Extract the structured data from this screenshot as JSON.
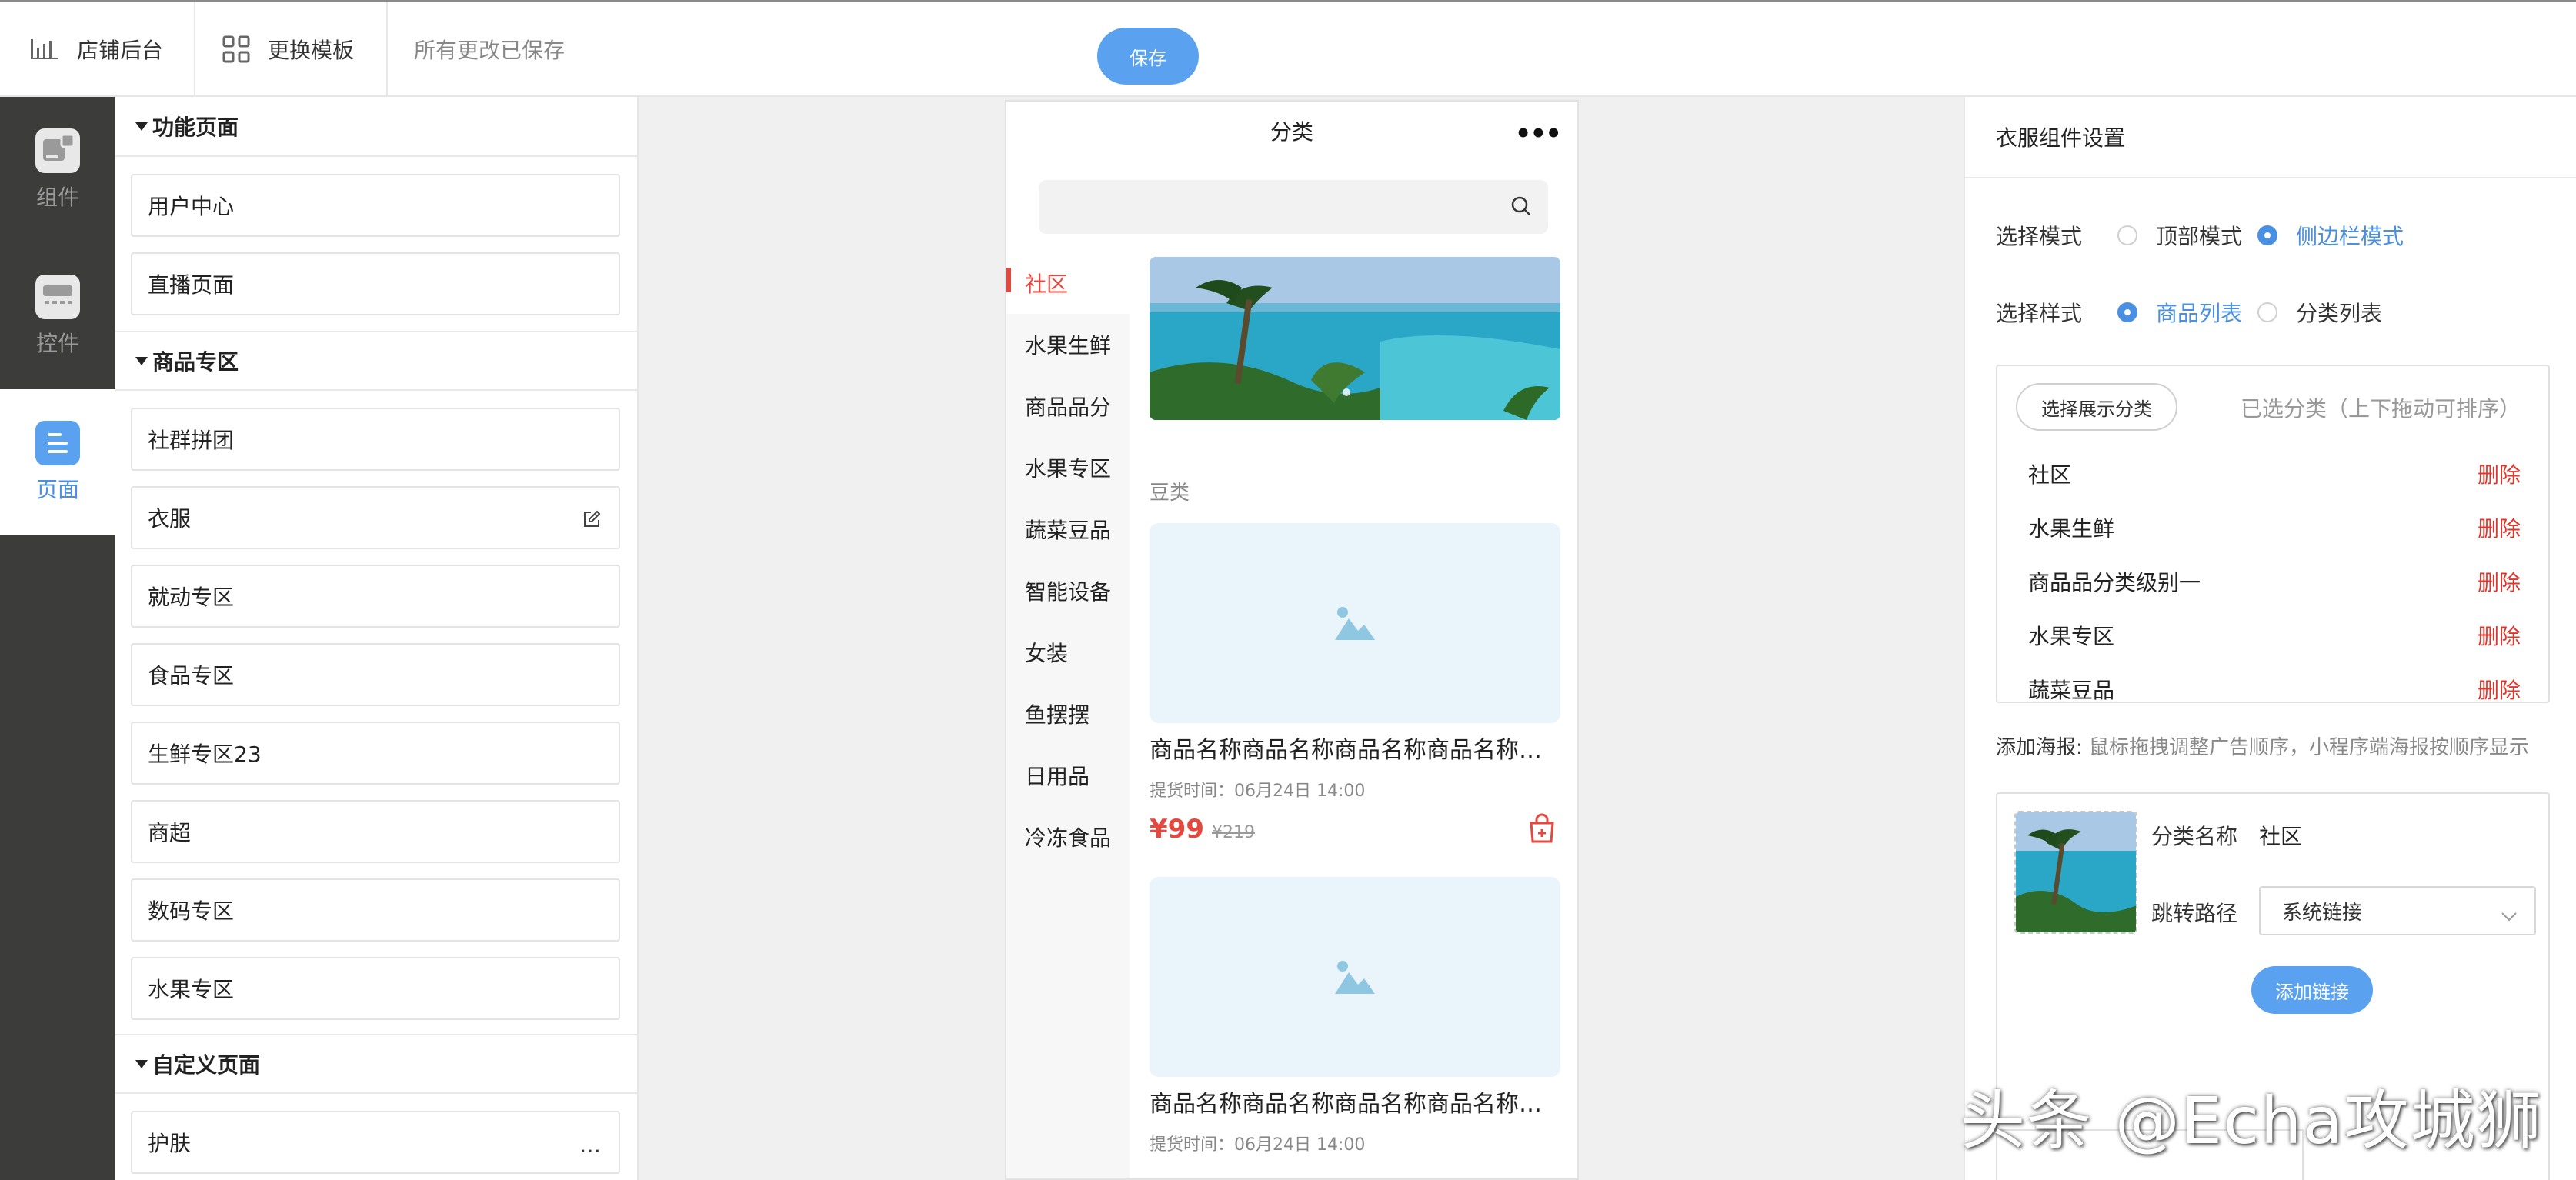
{
  "topbar": {
    "shop_admin": "店铺后台",
    "change_template": "更换模板",
    "saved_status": "所有更改已保存",
    "save_label": "保存"
  },
  "rail": {
    "items": [
      {
        "label": "组件",
        "icon": "component-icon"
      },
      {
        "label": "控件",
        "icon": "control-icon"
      },
      {
        "label": "页面",
        "icon": "page-icon",
        "active": true
      }
    ]
  },
  "left_panel": {
    "sections": [
      {
        "title": "功能页面",
        "items": [
          "用户中心",
          "直播页面"
        ]
      },
      {
        "title": "商品专区",
        "items": [
          "社群拼团",
          "衣服",
          "就动专区",
          "食品专区",
          "生鲜专区23",
          "商超",
          "数码专区",
          "水果专区"
        ]
      },
      {
        "title": "自定义页面",
        "items": [
          "护肤"
        ]
      }
    ]
  },
  "phone": {
    "title": "分类",
    "more": "•••",
    "categories": [
      "社区",
      "水果生鲜",
      "商品品分",
      "水果专区",
      "蔬菜豆品",
      "智能设备",
      "女装",
      "鱼摆摆",
      "日用品",
      "冷冻食品"
    ],
    "active_category": "社区",
    "group_title": "豆类",
    "products": [
      {
        "name": "商品名称商品名称商品名称商品名称商品名称",
        "time": "提货时间：06月24日 14:00",
        "price": "¥99",
        "original": "¥219"
      },
      {
        "name": "商品名称商品名称商品名称商品名称商品名称",
        "time": "提货时间：06月24日 14:00"
      }
    ]
  },
  "settings": {
    "title": "衣服组件设置",
    "mode_label": "选择模式",
    "mode_options": [
      "顶部模式",
      "侧边栏模式"
    ],
    "mode_selected": "侧边栏模式",
    "style_label": "选择样式",
    "style_options": [
      "商品列表",
      "分类列表"
    ],
    "style_selected": "商品列表",
    "pick_button": "选择展示分类",
    "picked_hint": "已选分类（上下拖动可排序）",
    "delete_label": "删除",
    "selected_categories": [
      "社区",
      "水果生鲜",
      "商品品分类级别一",
      "水果专区",
      "蔬菜豆品"
    ],
    "poster_label": "添加海报:",
    "poster_note": "鼠标拖拽调整广告顺序，小程序端海报按顺序显示",
    "poster": {
      "category_name_label": "分类名称",
      "category_name": "社区",
      "jump_path_label": "跳转路径",
      "jump_path_value": "系统链接",
      "add_link": "添加链接"
    }
  },
  "watermark": "头条 @Echa攻城狮",
  "colors": {
    "accent": "#5aa2f0",
    "active_text": "#4a90e2",
    "danger": "#e0362c",
    "price": "#e5483e",
    "rail_bg": "#3c3c3b"
  }
}
